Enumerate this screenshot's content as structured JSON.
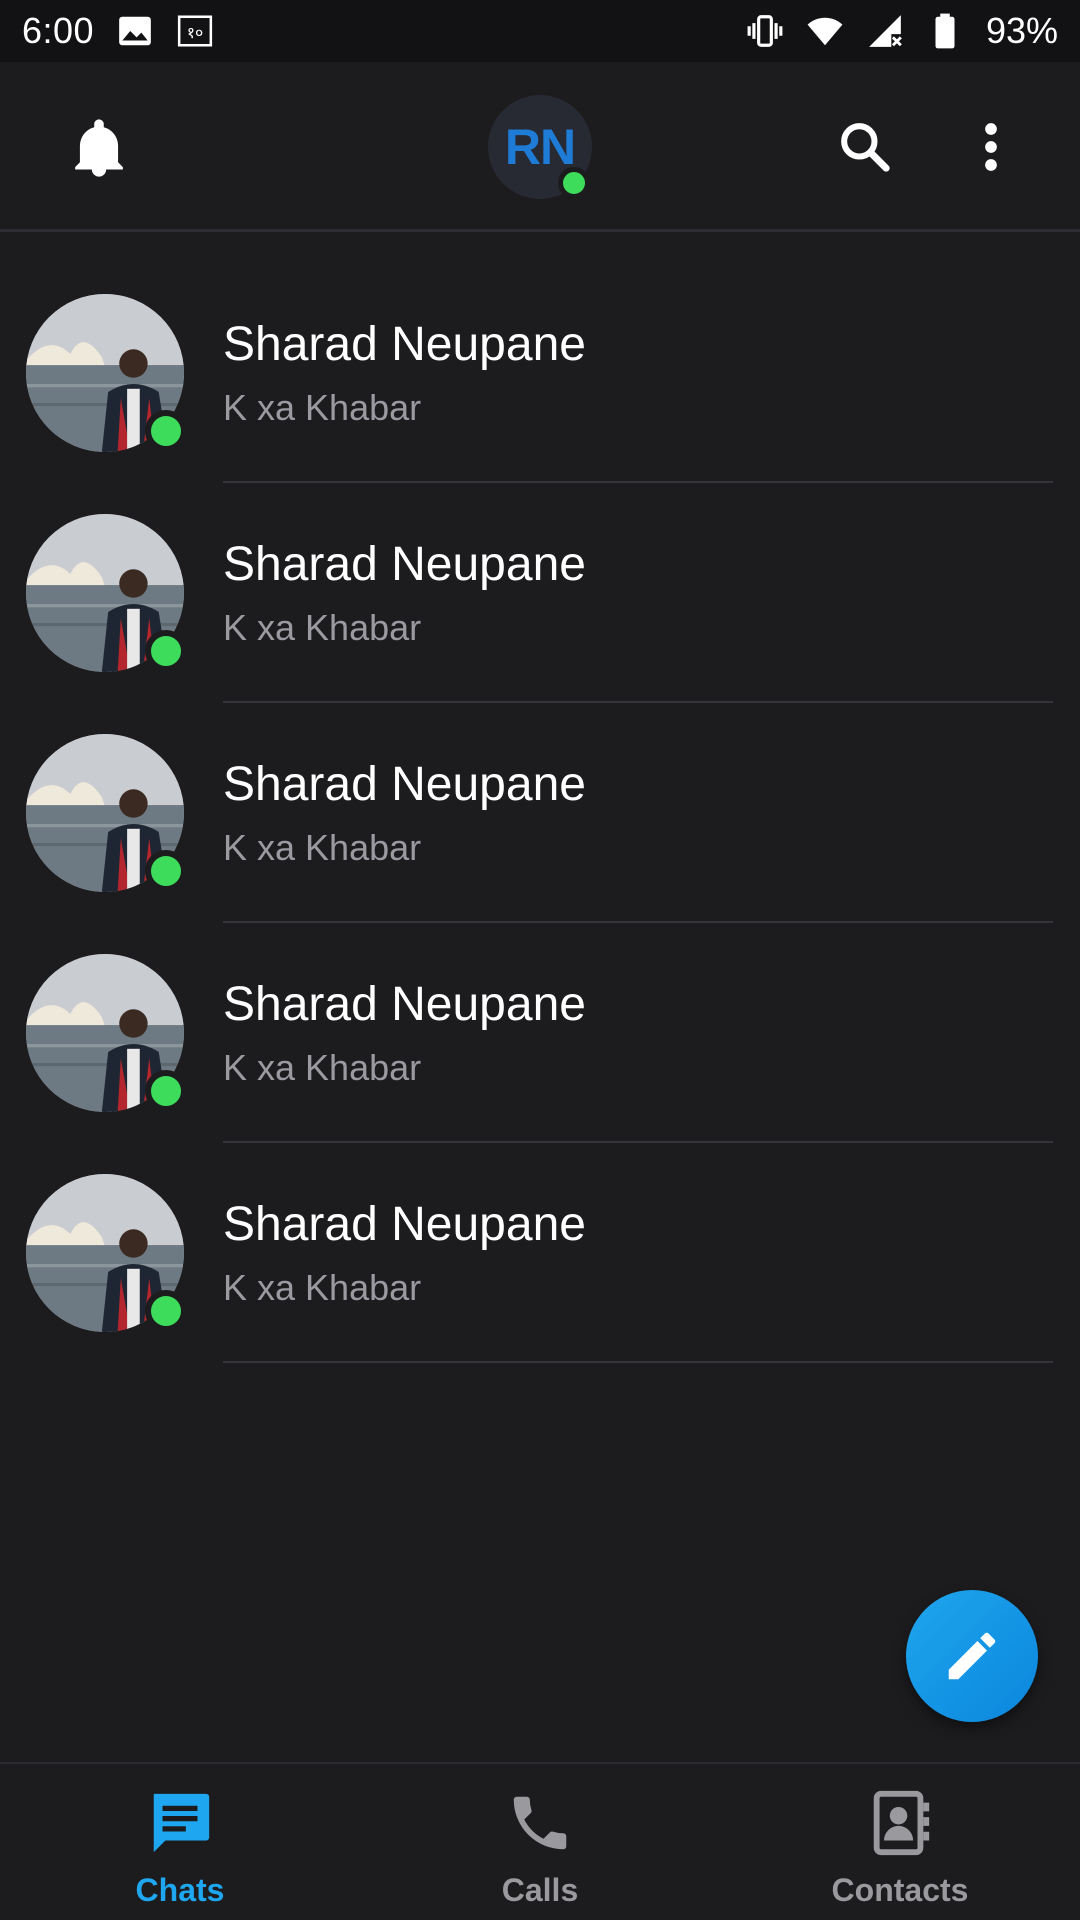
{
  "status_bar": {
    "time": "6:00",
    "battery_percent": "93%",
    "icons": [
      "image-icon",
      "data-saver-icon",
      "vibrate-icon",
      "wifi-icon",
      "signal-icon",
      "battery-icon"
    ]
  },
  "app_bar": {
    "user_initials": "RN",
    "user_online": true,
    "icons": [
      "bell-icon",
      "search-icon",
      "more-vert-icon"
    ]
  },
  "chats": [
    {
      "name": "Sharad Neupane",
      "message": "K xa Khabar",
      "online": true
    },
    {
      "name": "Sharad Neupane",
      "message": "K xa Khabar",
      "online": true
    },
    {
      "name": "Sharad Neupane",
      "message": "K xa Khabar",
      "online": true
    },
    {
      "name": "Sharad Neupane",
      "message": "K xa Khabar",
      "online": true
    },
    {
      "name": "Sharad Neupane",
      "message": "K xa Khabar",
      "online": true
    }
  ],
  "fab": {
    "icon": "pencil-icon"
  },
  "bottom_nav": {
    "items": [
      {
        "label": "Chats",
        "icon": "chat-icon",
        "active": true
      },
      {
        "label": "Calls",
        "icon": "phone-icon",
        "active": false
      },
      {
        "label": "Contacts",
        "icon": "contacts-icon",
        "active": false
      }
    ]
  },
  "colors": {
    "background": "#1c1c1f",
    "status_bar": "#121214",
    "accent": "#1ea7f0",
    "online": "#3ddc5b",
    "initials": "#1e7bd6",
    "secondary_text": "#9a9aa0"
  }
}
